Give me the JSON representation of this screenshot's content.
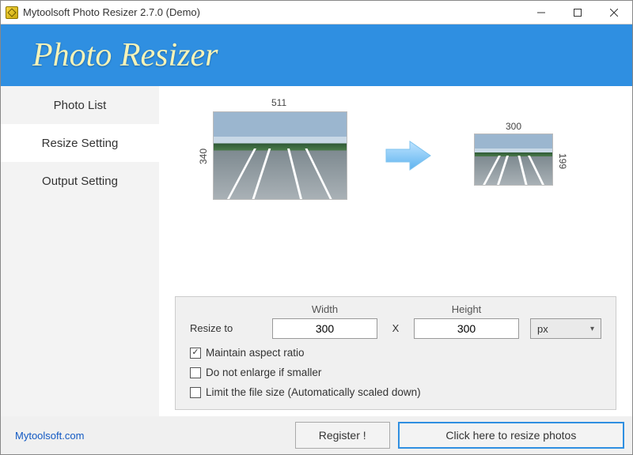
{
  "window": {
    "title": "Mytoolsoft Photo Resizer 2.7.0 (Demo)"
  },
  "header": {
    "brand": "Photo Resizer"
  },
  "sidebar": {
    "tabs": [
      {
        "label": "Photo List"
      },
      {
        "label": "Resize Setting"
      },
      {
        "label": "Output Setting"
      }
    ],
    "active_index": 1
  },
  "preview": {
    "src": {
      "width": "511",
      "height": "340"
    },
    "dst": {
      "width": "300",
      "height": "199"
    }
  },
  "settings": {
    "resize_to_label": "Resize to",
    "width_label": "Width",
    "height_label": "Height",
    "width_value": "300",
    "height_value": "300",
    "x_sep": "X",
    "unit": "px",
    "checks": [
      {
        "label": "Maintain aspect ratio",
        "checked": true
      },
      {
        "label": "Do not enlarge if smaller",
        "checked": false
      },
      {
        "label": "Limit the file size (Automatically scaled down)",
        "checked": false
      }
    ]
  },
  "footer": {
    "site": "Mytoolsoft.com",
    "register": "Register !",
    "action": "Click here to resize photos"
  }
}
